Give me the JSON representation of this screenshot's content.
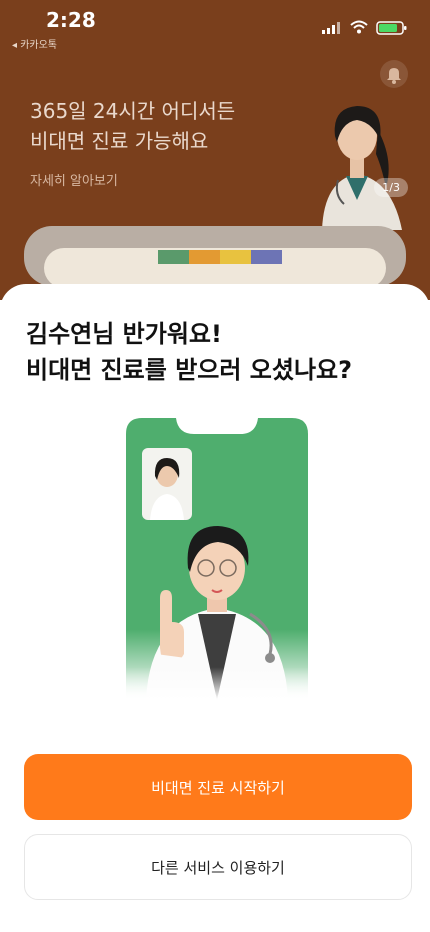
{
  "status_bar": {
    "time": "2:28",
    "back_label": "◂ 카카오톡"
  },
  "banner": {
    "title_line1": "365일 24시간 어디서든",
    "title_line2": "비대면 진료 가능해요",
    "subtitle": "자세히 알아보기",
    "page_indicator": "1/3"
  },
  "sheet": {
    "greeting_line1": "김수연님 반가워요!",
    "greeting_line2": "비대면 진료를 받으러 오셨나요?",
    "primary_button": "비대면 진료 시작하기",
    "secondary_button": "다른 서비스 이용하기"
  },
  "colors": {
    "banner_bg": "#7a3f1c",
    "primary": "#ff7a1a",
    "illustration_green": "#4fae6e",
    "strip": [
      "#5a9a6b",
      "#e39a32",
      "#e8c23f",
      "#6d74b5"
    ]
  },
  "icons": [
    "signal-icon",
    "wifi-icon",
    "battery-icon",
    "bell-icon"
  ]
}
